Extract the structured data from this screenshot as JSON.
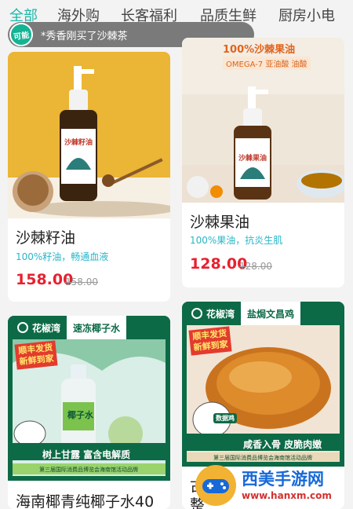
{
  "tabs": [
    {
      "label": "全部",
      "active": true
    },
    {
      "label": "海外购",
      "active": false
    },
    {
      "label": "长客福利",
      "active": false
    },
    {
      "label": "品质生鲜",
      "active": false
    },
    {
      "label": "厨房小电",
      "active": false
    }
  ],
  "toast": {
    "badge": "可能",
    "text": "*秀香刚买了沙棘茶"
  },
  "products": [
    {
      "title": "沙棘籽油",
      "subtitle": "100%籽油，畅通血液",
      "price": "158.00",
      "original_price": "158.00",
      "image": {
        "bottle_label": "沙棘籽油",
        "background": "#ebb535"
      }
    },
    {
      "title": "沙棘果油",
      "subtitle": "100%果油，抗炎生肌",
      "price": "128.00",
      "original_price": "128.00",
      "image": {
        "headline": "100%沙棘果油",
        "subline": "OMEGA-7  亚油酸  油酸",
        "bottle_label": "沙棘果油"
      }
    },
    {
      "title": "海南椰青纯椰子水40",
      "image": {
        "brand": "花椒湾",
        "tag": "速冻椰子水",
        "badge_line1": "顺丰发货",
        "badge_line2": "新鲜到家",
        "bottle_label": "椰子水",
        "slogan": "树上甘露 富含电解质",
        "footer": "第三届国际消费品博览会海南馆活动品牌"
      }
    },
    {
      "title": "古",
      "title_line2": "整",
      "image": {
        "brand": "花椒湾",
        "tag": "盐焗文昌鸡",
        "badge_line1": "顺丰发货",
        "badge_line2": "新鲜到家",
        "mascot_tag": "数据鸡",
        "slogan": "咸香入骨 皮脆肉嫩",
        "footer": "第三届国际消费品博览会海南馆活动品牌"
      }
    }
  ],
  "watermark": {
    "title": "西美手游网",
    "url": "www.hanxm.com"
  },
  "colors": {
    "accent_teal": "#1bb9a8",
    "price_red": "#e8202f",
    "subtitle_cyan": "#28b6c8",
    "brand_green": "#0d6a46"
  }
}
